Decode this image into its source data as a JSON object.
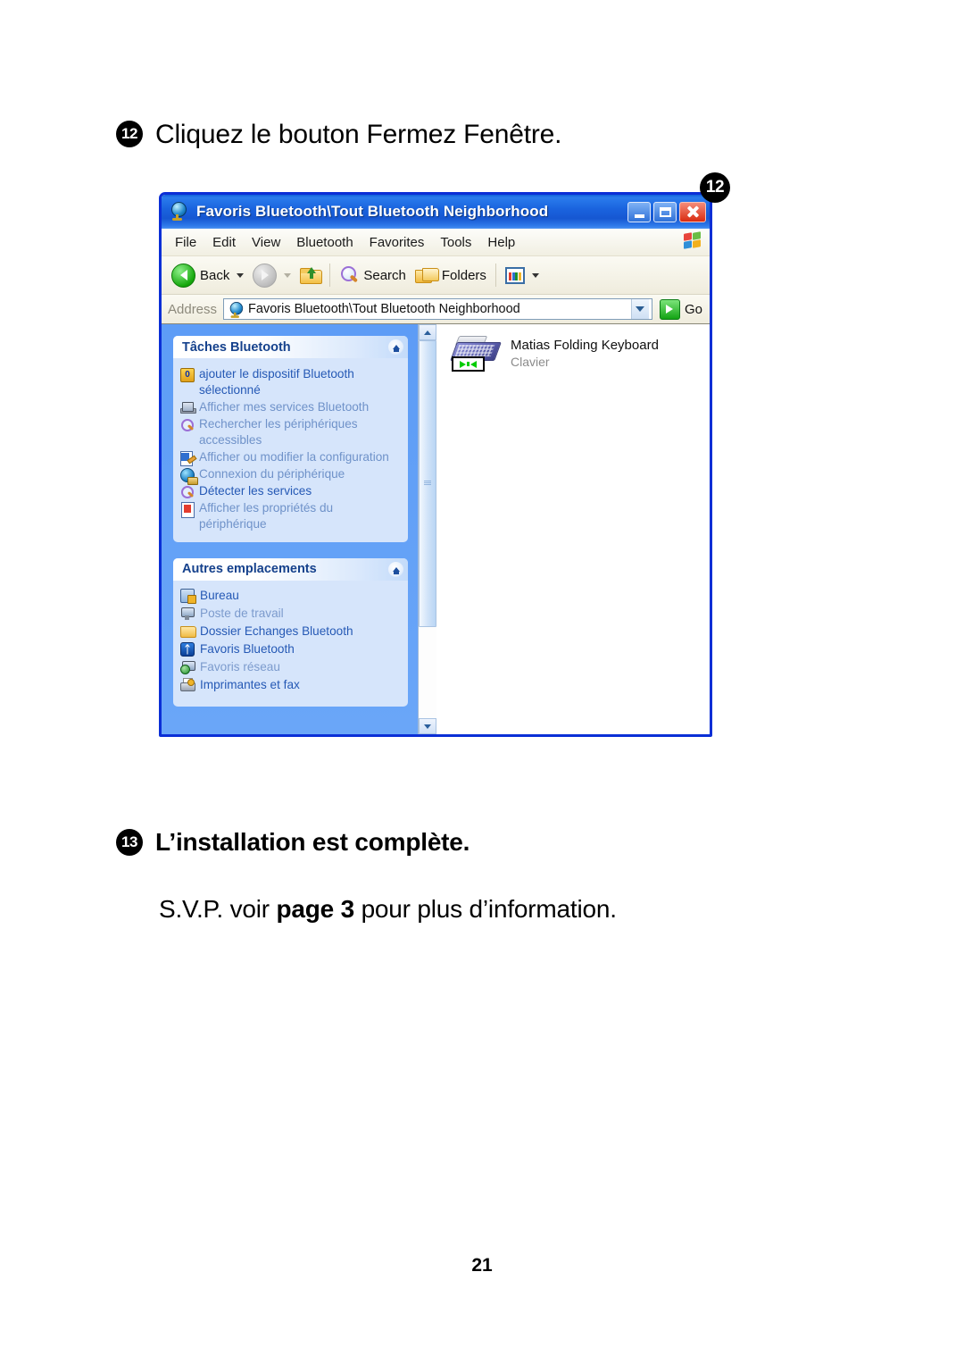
{
  "document": {
    "page_number": "21",
    "steps": [
      {
        "number": "12",
        "text": "Cliquez le bouton Fermez Fenêtre."
      },
      {
        "number": "13",
        "text": "L’installation est complète."
      }
    ],
    "subnote": {
      "before": "S.V.P. voir ",
      "emphasis": "page 3",
      "after": " pour plus d’information."
    }
  },
  "callout": {
    "label": "12"
  },
  "window": {
    "title": "Favoris Bluetooth\\Tout Bluetooth Neighborhood",
    "title_icon": "globe-icon",
    "controls": {
      "minimize": "minimize-button",
      "maximize": "maximize-button",
      "close": "close-button"
    },
    "menu": [
      "File",
      "Edit",
      "View",
      "Bluetooth",
      "Favorites",
      "Tools",
      "Help"
    ],
    "menu_brand_icon": "windows-flag-icon",
    "toolbar": {
      "back_label": "Back",
      "forward_label": "",
      "up_label": "",
      "search_label": "Search",
      "folders_label": "Folders",
      "views_label": ""
    },
    "address": {
      "label": "Address",
      "value": "Favoris Bluetooth\\Tout Bluetooth Neighborhood",
      "go_label": "Go"
    },
    "sidebar": {
      "panels": [
        {
          "title": "Tâches Bluetooth",
          "items": [
            {
              "label": "ajouter le dispositif Bluetooth sélectionné",
              "icon": "bluetooth-add-icon",
              "dim": false
            },
            {
              "label": "Afficher mes services Bluetooth",
              "icon": "laptop-icon",
              "dim": true
            },
            {
              "label": "Rechercher les périphériques accessibles",
              "icon": "magnifier-icon",
              "dim": true
            },
            {
              "label": "Afficher ou modifier la configuration",
              "icon": "configure-icon",
              "dim": true
            },
            {
              "label": "Connexion du périphérique",
              "icon": "globe-icon",
              "dim": true
            },
            {
              "label": "Détecter les services",
              "icon": "magnifier-icon",
              "dim": false
            },
            {
              "label": "Afficher les propriétés du périphérique",
              "icon": "properties-icon",
              "dim": true
            }
          ]
        },
        {
          "title": "Autres emplacements",
          "items": [
            {
              "label": "Bureau",
              "icon": "desktop-icon",
              "dim": false
            },
            {
              "label": "Poste de travail",
              "icon": "my-computer-icon",
              "dim": true
            },
            {
              "label": "Dossier Echanges Bluetooth",
              "icon": "folder-icon",
              "dim": false
            },
            {
              "label": "Favoris Bluetooth",
              "icon": "bluetooth-icon",
              "dim": false
            },
            {
              "label": "Favoris réseau",
              "icon": "network-icon",
              "dim": true
            },
            {
              "label": "Imprimantes et fax",
              "icon": "printer-icon",
              "dim": false
            }
          ]
        }
      ]
    },
    "content": {
      "items": [
        {
          "name": "Matias Folding Keyboard",
          "type": "Clavier",
          "icon": "keyboard-device-icon"
        }
      ]
    },
    "scrollbar": {
      "up": "scroll-up-button",
      "down": "scroll-down-button",
      "thumb": "scroll-thumb"
    }
  },
  "colors": {
    "title_bar_blue": "#1a63de",
    "window_border": "#0b2fd6",
    "sidebar_blue": "#5d9cf6",
    "panel_body": "#d6e5fb",
    "link_blue": "#2559b5",
    "panel_title": "#15418c",
    "close_red": "#d92b11"
  }
}
